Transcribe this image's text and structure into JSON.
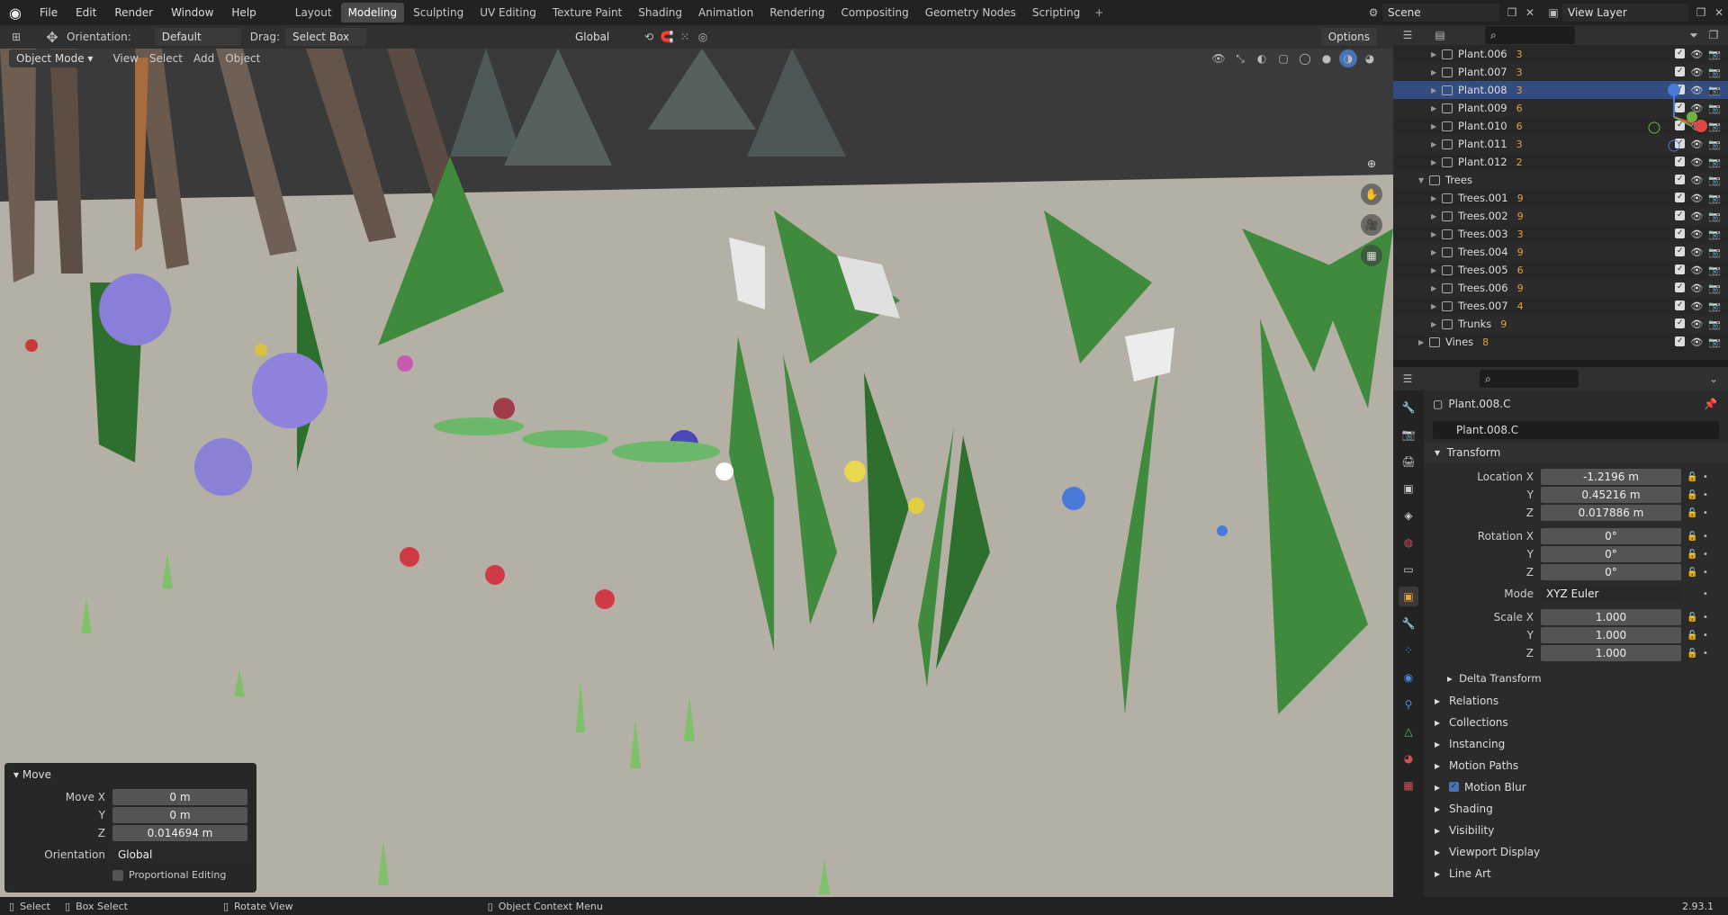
{
  "topbar": {
    "menu": [
      "File",
      "Edit",
      "Render",
      "Window",
      "Help"
    ],
    "workspaces": [
      "Layout",
      "Modeling",
      "Sculpting",
      "UV Editing",
      "Texture Paint",
      "Shading",
      "Animation",
      "Rendering",
      "Compositing",
      "Geometry Nodes",
      "Scripting"
    ],
    "active_workspace": "Modeling",
    "scene": "Scene",
    "view_layer": "View Layer"
  },
  "tool_header": {
    "orientation_label": "Orientation:",
    "orientation_value": "Default",
    "drag_label": "Drag:",
    "drag_value": "Select Box",
    "transform_orientation": "Global",
    "options": "Options"
  },
  "viewport_header": {
    "mode": "Object Mode",
    "menus": [
      "View",
      "Select",
      "Add",
      "Object"
    ]
  },
  "move_panel": {
    "title": "Move",
    "move_x_label": "Move X",
    "move_x": "0 m",
    "y_label": "Y",
    "move_y": "0 m",
    "z_label": "Z",
    "move_z": "0.014694 m",
    "orientation_label": "Orientation",
    "orientation": "Global",
    "proportional": "Proportional Editing"
  },
  "outliner": {
    "rows": [
      {
        "name": "Plant.006",
        "mod": "3",
        "level": 1
      },
      {
        "name": "Plant.007",
        "mod": "3",
        "level": 1
      },
      {
        "name": "Plant.008",
        "mod": "3",
        "level": 1
      },
      {
        "name": "Plant.009",
        "mod": "6",
        "level": 1
      },
      {
        "name": "Plant.010",
        "mod": "6",
        "level": 1
      },
      {
        "name": "Plant.011",
        "mod": "3",
        "level": 1
      },
      {
        "name": "Plant.012",
        "mod": "2",
        "level": 1
      },
      {
        "name": "Trees",
        "mod": "",
        "level": 0
      },
      {
        "name": "Trees.001",
        "mod": "9",
        "level": 1
      },
      {
        "name": "Trees.002",
        "mod": "9",
        "level": 1
      },
      {
        "name": "Trees.003",
        "mod": "3",
        "level": 1
      },
      {
        "name": "Trees.004",
        "mod": "9",
        "level": 1
      },
      {
        "name": "Trees.005",
        "mod": "6",
        "level": 1
      },
      {
        "name": "Trees.006",
        "mod": "9",
        "level": 1
      },
      {
        "name": "Trees.007",
        "mod": "4",
        "level": 1
      },
      {
        "name": "Trunks",
        "mod": "9",
        "level": 1
      },
      {
        "name": "Vines",
        "mod": "8",
        "level": 0
      }
    ]
  },
  "properties": {
    "object_name": "Plant.008.C",
    "datablock": "Plant.008.C",
    "transform_title": "Transform",
    "location_x_label": "Location X",
    "location_x": "-1.2196 m",
    "location_y": "0.45216 m",
    "location_z": "0.017886 m",
    "rotation_x_label": "Rotation X",
    "rotation_x": "0°",
    "rotation_y": "0°",
    "rotation_z": "0°",
    "mode_label": "Mode",
    "mode": "XYZ Euler",
    "scale_x_label": "Scale X",
    "scale_x": "1.000",
    "scale_y": "1.000",
    "scale_z": "1.000",
    "y_label": "Y",
    "z_label": "Z",
    "delta": "Delta Transform",
    "sections": [
      "Relations",
      "Collections",
      "Instancing",
      "Motion Paths",
      "Motion Blur",
      "Shading",
      "Visibility",
      "Viewport Display",
      "Line Art"
    ]
  },
  "statusbar": {
    "select": "Select",
    "box_select": "Box Select",
    "rotate": "Rotate View",
    "context": "Object Context Menu",
    "version": "2.93.1"
  },
  "colors": {
    "ground": "#b5b0a5",
    "sky": "#3d3d3d",
    "leaf": "#3d8a3a",
    "selection": "#334d80",
    "modifier": "#e8a040"
  }
}
